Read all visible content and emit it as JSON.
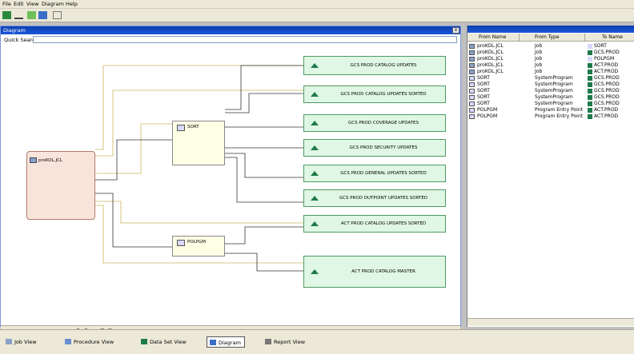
{
  "menu": [
    "File",
    "Edit",
    "View",
    "Diagram",
    "Help"
  ],
  "diagram_window": {
    "title": "Diagram",
    "close_label": "x",
    "quick_search_label": "Quick Search:",
    "quick_search_value": ""
  },
  "job_node": {
    "label": "proKOL.JCL"
  },
  "program_nodes": [
    {
      "label": "SORT"
    },
    {
      "label": "POLPGM"
    }
  ],
  "dataset_nodes": [
    {
      "label": "GCS PROD CATALOG UPDATES"
    },
    {
      "label": "GCS PROD CATALOG UPDATES SORTED"
    },
    {
      "label": "GCS PROD COVERAGE UPDATES"
    },
    {
      "label": "GCS PROD SECURITY UPDATES"
    },
    {
      "label": "GCS PROD GENERAL UPDATES SORTED"
    },
    {
      "label": "GCS PROD OUTPOINT UPDATES SORTED"
    },
    {
      "label": "ACT PROD CATALOG UPDATES SORTED"
    },
    {
      "label": "ACT PROD CATALOG MASTER"
    }
  ],
  "right_panel": {
    "columns": [
      "From Name",
      "From Type",
      "To Name"
    ],
    "rows": [
      [
        "proKOL.JCL",
        "Job",
        "SORT"
      ],
      [
        "proKOL.JCL",
        "Job",
        "GCS.PROD"
      ],
      [
        "proKOL.JCL",
        "Job",
        "POLPGM"
      ],
      [
        "proKOL.JCL",
        "Job",
        "ACT.PROD"
      ],
      [
        "proKOL.JCL",
        "Job",
        "ACT.PROD"
      ],
      [
        "SORT",
        "SystemProgram",
        "GCS.PROD"
      ],
      [
        "SORT",
        "SystemProgram",
        "GCS.PROD"
      ],
      [
        "SORT",
        "SystemProgram",
        "GCS.PROD"
      ],
      [
        "SORT",
        "SystemProgram",
        "GCS.PROD"
      ],
      [
        "SORT",
        "SystemProgram",
        "GCS.PROD"
      ],
      [
        "POLPGM",
        "Program Entry Point",
        "ACT.PROD"
      ],
      [
        "POLPGM",
        "Program Entry Point",
        "ACT.PROD"
      ]
    ]
  },
  "tabs": [
    {
      "label": "Job View",
      "active": false
    },
    {
      "label": "Procedure View",
      "active": false
    },
    {
      "label": "Data Set View",
      "active": false
    },
    {
      "label": "Diagram",
      "active": true
    },
    {
      "label": "Report View",
      "active": false
    }
  ],
  "colors": {
    "title_bar": "#1a57d8",
    "dataset_fill": "#dff7e4",
    "job_fill": "#f9e4dc",
    "program_fill": "#ffffe6"
  }
}
